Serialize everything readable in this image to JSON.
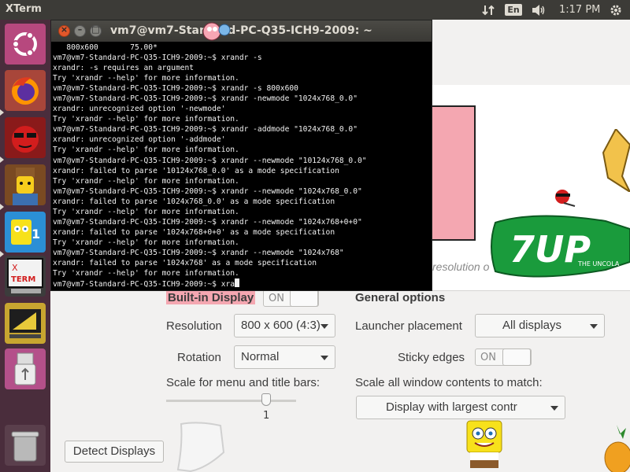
{
  "top_panel": {
    "app_title": "XTerm",
    "language": "En",
    "clock": "1:17 PM",
    "icons": [
      "network-arrows-icon",
      "keyboard-language-icon",
      "volume-icon",
      "system-gear-icon"
    ]
  },
  "launcher": {
    "items": [
      {
        "name": "ubuntu-dash-icon",
        "label": "Dash"
      },
      {
        "name": "firefox-icon",
        "label": "Firefox"
      },
      {
        "name": "devil-game-icon",
        "label": "Game"
      },
      {
        "name": "lego-character-icon",
        "label": "Lego"
      },
      {
        "name": "spongebob-game-icon",
        "label": "SpongeBob"
      },
      {
        "name": "xterm-icon",
        "label": "XTERM"
      },
      {
        "name": "ruler-app-icon",
        "label": "Drawing"
      },
      {
        "name": "usb-drive-icon",
        "label": "USB"
      },
      {
        "name": "trash-icon",
        "label": "Trash"
      }
    ]
  },
  "xterm": {
    "title": "vm7@vm7-Standard-PC-Q35-ICH9-2009: ~",
    "lines": [
      "   800x600       75.00*",
      "vm7@vm7-Standard-PC-Q35-ICH9-2009:~$ xrandr -s",
      "xrandr: -s requires an argument",
      "Try 'xrandr --help' for more information.",
      "vm7@vm7-Standard-PC-Q35-ICH9-2009:~$ xrandr -s 800x600",
      "vm7@vm7-Standard-PC-Q35-ICH9-2009:~$ xrandr -newmode \"1024x768_0.0\"",
      "xrandr: unrecognized option '-newmode'",
      "Try 'xrandr --help' for more information.",
      "vm7@vm7-Standard-PC-Q35-ICH9-2009:~$ xrandr -addmode \"1024x768_0.0\"",
      "xrandr: unrecognized option '-addmode'",
      "Try 'xrandr --help' for more information.",
      "vm7@vm7-Standard-PC-Q35-ICH9-2009:~$ xrandr --newmode \"10124x768_0.0\"",
      "xrandr: failed to parse '10124x768_0.0' as a mode specification",
      "Try 'xrandr --help' for more information.",
      "vm7@vm7-Standard-PC-Q35-ICH9-2009:~$ xrandr --newmode \"1024x768_0.0\"",
      "xrandr: failed to parse '1024x768_0.0' as a mode specification",
      "Try 'xrandr --help' for more information.",
      "vm7@vm7-Standard-PC-Q35-ICH9-2009:~$ xrandr --newmode \"1024x768+0+0\"",
      "xrandr: failed to parse '1024x768+0+0' as a mode specification",
      "Try 'xrandr --help' for more information.",
      "vm7@vm7-Standard-PC-Q35-ICH9-2009:~$ xrandr --newmode \"1024x768\"",
      "xrandr: failed to parse '1024x768' as a mode specification",
      "Try 'xrandr --help' for more information."
    ],
    "prompt_line": "vm7@vm7-Standard-PC-Q35-ICH9-2009:~$ xra"
  },
  "displays": {
    "resolution_hint": "resolution o",
    "built_in_display": "Built-in Display",
    "display_switch": "ON",
    "resolution_label": "Resolution",
    "resolution_value": "800 x 600 (4:3)",
    "rotation_label": "Rotation",
    "rotation_value": "Normal",
    "scale_label": "Scale for menu and title bars:",
    "scale_value": "1",
    "general_options": "General options",
    "launcher_placement_label": "Launcher placement",
    "launcher_placement_value": "All displays",
    "sticky_edges_label": "Sticky edges",
    "sticky_edges_switch": "ON",
    "scale_all_label": "Scale all window contents to match:",
    "scale_all_value": "Display with largest contr",
    "detect_button": "Detect Displays"
  },
  "decor": {
    "seven_up_text": "7UP",
    "seven_up_tagline": "THE UNCOLA"
  },
  "colors": {
    "panel": "#3c3b37",
    "launcher": "#4a2d3c",
    "close_button": "#e2572a",
    "display_preview": "#f4a7b1"
  }
}
